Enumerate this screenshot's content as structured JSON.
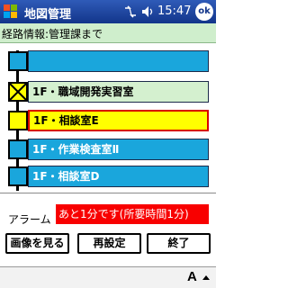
{
  "titlebar": {
    "app_title": "地図管理",
    "clock": "15:47",
    "ok_label": "ok"
  },
  "route_header": {
    "label": "経路情報:管理課まで"
  },
  "route": {
    "rows": [
      {
        "label": "",
        "style": "blue",
        "node": "square"
      },
      {
        "label": "1F・職域開発実習室",
        "style": "green",
        "node": "crossed"
      },
      {
        "label": "1F・相談室E",
        "style": "yellow-current",
        "node": "filled-yellow"
      },
      {
        "label": "1F・作業検査室Ⅱ",
        "style": "blue",
        "node": "square"
      },
      {
        "label": "1F・相談室D",
        "style": "blue",
        "node": "square"
      }
    ]
  },
  "alarm": {
    "label": "アラーム",
    "value": "あと1分です(所要時間1分)"
  },
  "buttons": {
    "view_image": "画像を見る",
    "reset": "再設定",
    "end": "終了"
  },
  "menubar": {
    "ime_label": "A"
  },
  "colors": {
    "titlebar": "#12358a",
    "header_bg": "#cfeecc",
    "row_blue": "#1aa6dc",
    "row_green": "#d4f0cf",
    "row_current": "#ffff00",
    "alarm_bg": "#f80000"
  }
}
